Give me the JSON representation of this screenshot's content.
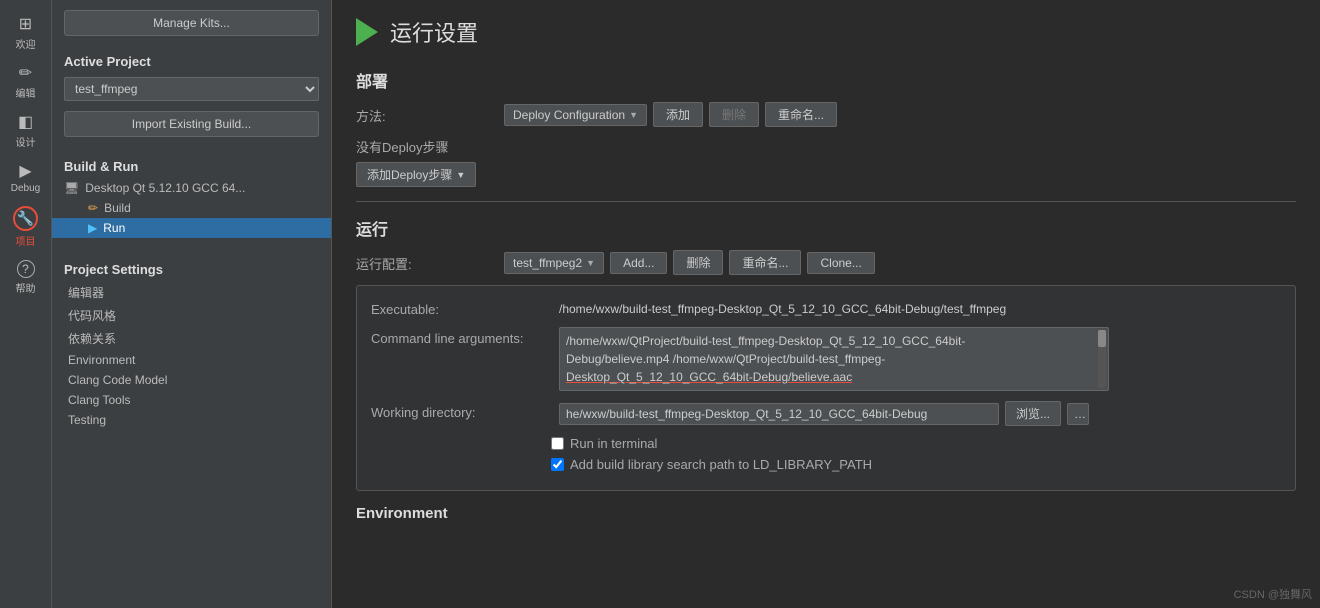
{
  "sidebar_icons": [
    {
      "id": "grid",
      "glyph": "⊞",
      "label": "欢迎",
      "active": false
    },
    {
      "id": "edit",
      "glyph": "✎",
      "label": "编辑",
      "active": false
    },
    {
      "id": "design",
      "glyph": "◈",
      "label": "设计",
      "active": false
    },
    {
      "id": "debug",
      "glyph": "▶",
      "label": "Debug",
      "active": false
    },
    {
      "id": "wrench",
      "glyph": "🔧",
      "label": "项目",
      "active": true,
      "highlighted": true
    },
    {
      "id": "help",
      "glyph": "?",
      "label": "帮助",
      "active": false
    }
  ],
  "left_panel": {
    "manage_kits_btn": "Manage Kits...",
    "active_project_label": "Active Project",
    "project_select_value": "test_ffmpeg",
    "import_btn": "Import Existing Build...",
    "build_run_label": "Build & Run",
    "desktop_item": "Desktop Qt 5.12.10 GCC 64...",
    "build_item": "Build",
    "run_item": "Run",
    "project_settings_label": "Project Settings",
    "settings_links": [
      "编辑器",
      "代码风格",
      "依赖关系",
      "Environment",
      "Clang Code Model",
      "Clang Tools",
      "Testing"
    ]
  },
  "main": {
    "page_title": "运行设置",
    "deploy_section_title": "部署",
    "method_label": "方法:",
    "deploy_config_value": "Deploy Configuration",
    "add_btn": "添加",
    "delete_btn": "删除",
    "rename_btn": "重命名...",
    "no_steps_text": "没有Deploy步骤",
    "add_step_btn": "添加Deploy步骤",
    "run_section_title": "运行",
    "run_config_label": "运行配置:",
    "run_config_value": "test_ffmpeg2",
    "run_add_btn": "Add...",
    "run_delete_btn": "删除",
    "run_rename_btn": "重命名...",
    "clone_btn": "Clone...",
    "executable_label": "Executable:",
    "executable_value": "/home/wxw/build-test_ffmpeg-Desktop_Qt_5_12_10_GCC_64bit-Debug/test_ffmpeg",
    "cmd_args_label": "Command line arguments:",
    "cmd_args_line1": "/home/wxw/QtProject/build-test_ffmpeg-Desktop_Qt_5_12_10_GCC_64bit-",
    "cmd_args_line2": "Debug/believe.mp4 /home/wxw/QtProject/build-test_ffmpeg-",
    "cmd_args_line3": "Desktop_Qt_5_12_10_GCC_64bit-Debug/believe.aac",
    "working_dir_label": "Working directory:",
    "working_dir_value": "he/wxw/build-test_ffmpeg-Desktop_Qt_5_12_10_GCC_64bit-Debug",
    "browse_btn": "浏览...",
    "run_in_terminal_label": "Run in terminal",
    "run_in_terminal_checked": false,
    "add_build_library_label": "Add build library search path to LD_LIBRARY_PATH",
    "add_build_library_checked": true,
    "environment_title": "Environment"
  },
  "watermark": "CSDN @独舞风"
}
